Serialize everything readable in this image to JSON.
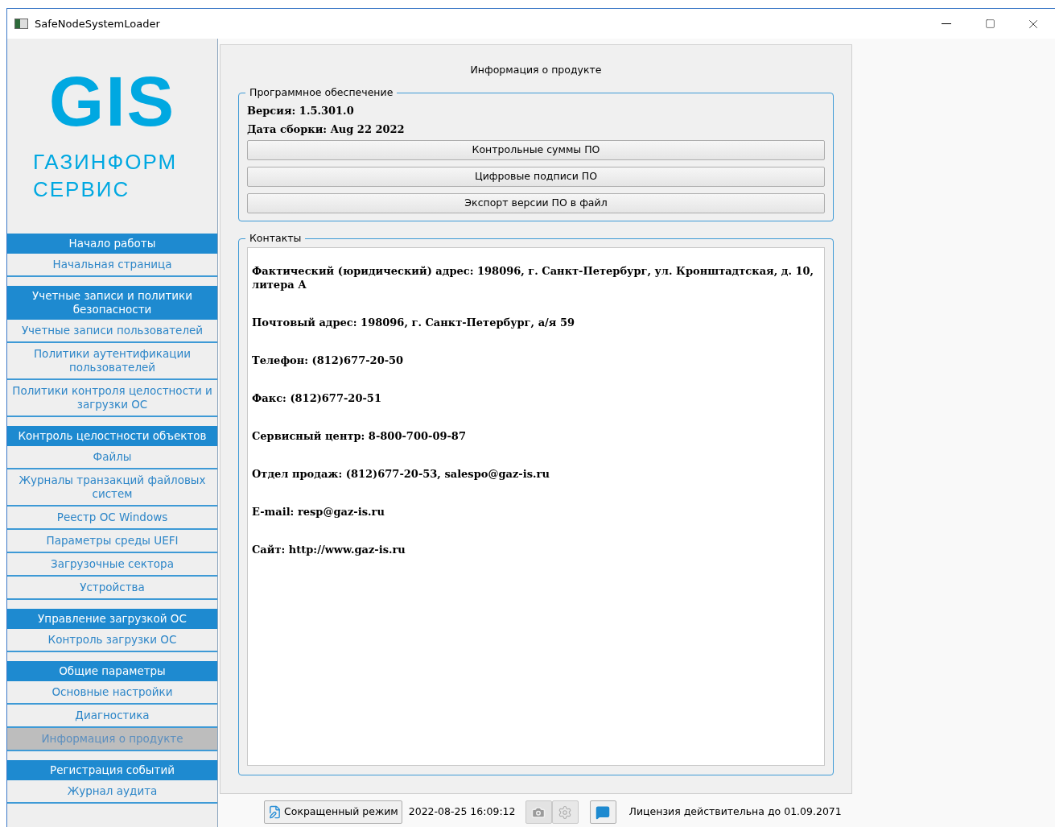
{
  "window": {
    "title": "SafeNodeSystemLoader"
  },
  "logo": {
    "mark": "GIS",
    "line1": "ГАЗИНФОРМ",
    "line2": "СЕРВИС"
  },
  "sidebar": {
    "groups": [
      {
        "title": "Начало работы",
        "items": [
          {
            "label": "Начальная страница",
            "selected": false
          }
        ]
      },
      {
        "title": "Учетные записи и политики безопасности",
        "items": [
          {
            "label": "Учетные записи пользователей",
            "selected": false
          },
          {
            "label": "Политики аутентификации пользователей",
            "selected": false
          },
          {
            "label": "Политики контроля целостности и загрузки ОС",
            "selected": false
          }
        ]
      },
      {
        "title": "Контроль целостности объектов",
        "items": [
          {
            "label": "Файлы",
            "selected": false
          },
          {
            "label": "Журналы транзакций файловых систем",
            "selected": false
          },
          {
            "label": "Реестр ОС Windows",
            "selected": false
          },
          {
            "label": "Параметры среды UEFI",
            "selected": false
          },
          {
            "label": "Загрузочные сектора",
            "selected": false
          },
          {
            "label": "Устройства",
            "selected": false
          }
        ]
      },
      {
        "title": "Управление загрузкой ОС",
        "items": [
          {
            "label": "Контроль загрузки ОС",
            "selected": false
          }
        ]
      },
      {
        "title": "Общие параметры",
        "items": [
          {
            "label": "Основные настройки",
            "selected": false
          },
          {
            "label": "Диагностика",
            "selected": false
          },
          {
            "label": "Информация о продукте",
            "selected": true
          }
        ]
      },
      {
        "title": "Регистрация событий",
        "items": [
          {
            "label": "Журнал аудита",
            "selected": false
          }
        ]
      }
    ]
  },
  "page": {
    "title": "Информация о продукте",
    "software": {
      "legend": "Программное обеспечение",
      "version": "Версия: 1.5.301.0",
      "build_date": "Дата сборки: Aug 22 2022",
      "buttons": [
        "Контрольные суммы ПО",
        "Цифровые подписи ПО",
        "Экспорт версии ПО в файл"
      ]
    },
    "contacts": {
      "legend": "Контакты",
      "lines": [
        "Фактический (юридический) адрес: 198096, г. Санкт-Петербург, ул. Кронштадтская, д. 10, литера А",
        "Почтовый адрес: 198096, г. Санкт-Петербург, а/я 59",
        "Телефон: (812)677-20-50",
        "Факс: (812)677-20-51",
        "Сервисный центр: 8-800-700-09-87",
        "Отдел продаж: (812)677-20-53, salespo@gaz-is.ru",
        "E-mail: resp@gaz-is.ru",
        "Сайт: http://www.gaz-is.ru"
      ]
    }
  },
  "status_bar": {
    "mode_button": "Сокращенный режим",
    "datetime": "2022-08-25 16:09:12",
    "screenshot_disabled": true,
    "settings_disabled": true,
    "license": "Лицензия действительна до 01.09.2071"
  }
}
